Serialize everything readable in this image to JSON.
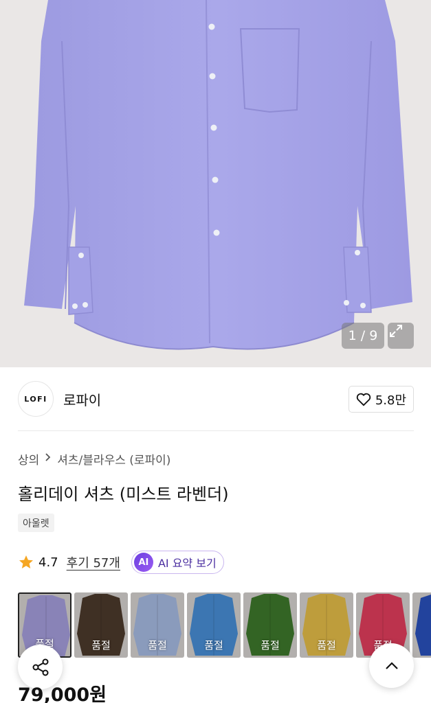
{
  "gallery": {
    "counter": "1 / 9",
    "image_alt": "shirt-photo"
  },
  "brand": {
    "logo_text": "LOFI",
    "name": "로파이",
    "like_count": "5.8만"
  },
  "breadcrumb": {
    "category": "상의",
    "subcategory": "셔츠/블라우스 (로파이)"
  },
  "product": {
    "title": "홀리데이 셔츠 (미스트 라벤더)",
    "tag": "아울렛",
    "price": "79,000원"
  },
  "rating": {
    "score": "4.7",
    "reviews": "후기 57개",
    "ai_badge": "AI",
    "ai_label": "AI 요약 보기"
  },
  "swatches": [
    {
      "color": "#a8a0e0",
      "label": "품절",
      "selected": true
    },
    {
      "color": "#4e3b2c",
      "label": "품절",
      "selected": false
    },
    {
      "color": "#a9bde6",
      "label": "품절",
      "selected": false
    },
    {
      "color": "#4a90d9",
      "label": "품절",
      "selected": false
    },
    {
      "color": "#3f7a2c",
      "label": "품절",
      "selected": false
    },
    {
      "color": "#e8c04a",
      "label": "품절",
      "selected": false
    },
    {
      "color": "#e63f5f",
      "label": "품절",
      "selected": false
    },
    {
      "color": "#2a52c0",
      "label": "품",
      "selected": false
    }
  ],
  "colors": {
    "shirt": "#a5a3e6",
    "star": "#f5a623",
    "ai_accent": "#6c3fe0"
  }
}
